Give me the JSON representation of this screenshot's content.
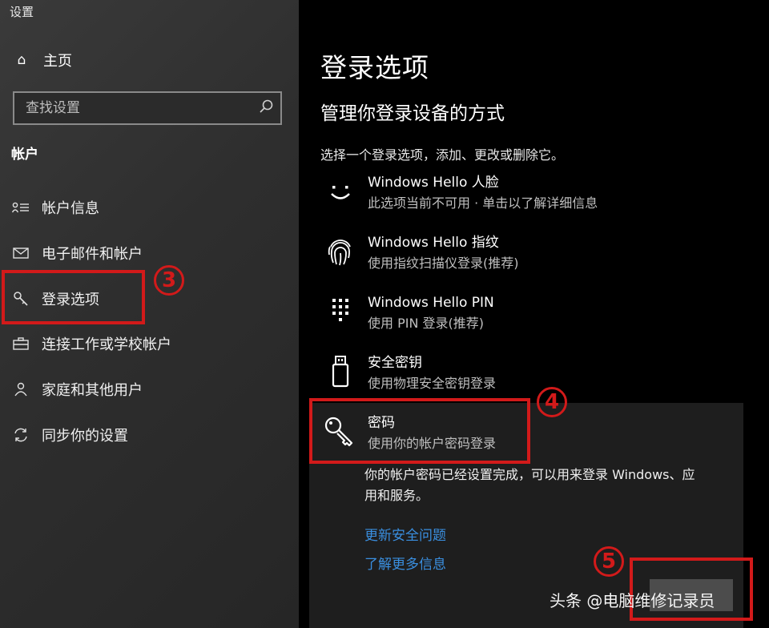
{
  "app": {
    "title": "设置"
  },
  "sidebar": {
    "home_label": "主页",
    "search_placeholder": "查找设置",
    "section_label": "帐户",
    "items": [
      {
        "label": "帐户信息",
        "icon": "account-info-icon"
      },
      {
        "label": "电子邮件和帐户",
        "icon": "mail-icon"
      },
      {
        "label": "登录选项",
        "icon": "key-icon"
      },
      {
        "label": "连接工作或学校帐户",
        "icon": "briefcase-icon"
      },
      {
        "label": "家庭和其他用户",
        "icon": "person-icon"
      },
      {
        "label": "同步你的设置",
        "icon": "sync-icon"
      }
    ]
  },
  "main": {
    "title": "登录选项",
    "subtitle": "管理你登录设备的方式",
    "instruction": "选择一个登录选项，添加、更改或删除它。",
    "options": [
      {
        "name": "Windows Hello 人脸",
        "desc": "此选项当前不可用 · 单击以了解详细信息",
        "icon": "smiley-face-icon"
      },
      {
        "name": "Windows Hello 指纹",
        "desc": "使用指纹扫描仪登录(推荐)",
        "icon": "fingerprint-icon"
      },
      {
        "name": "Windows Hello PIN",
        "desc": "使用 PIN 登录(推荐)",
        "icon": "pin-keypad-icon"
      },
      {
        "name": "安全密钥",
        "desc": "使用物理安全密钥登录",
        "icon": "usb-key-icon"
      },
      {
        "name": "密码",
        "desc": "使用你的帐户密码登录",
        "icon": "password-key-icon"
      }
    ],
    "password_detail": "你的帐户密码已经设置完成，可以用来登录 Windows、应用和服务。",
    "links": [
      "更新安全问题",
      "了解更多信息"
    ]
  },
  "annotations": {
    "step3": "3",
    "step4": "4",
    "step5": "5",
    "color": "#d21a1a"
  },
  "watermark": "头条 @电脑维修记录员"
}
